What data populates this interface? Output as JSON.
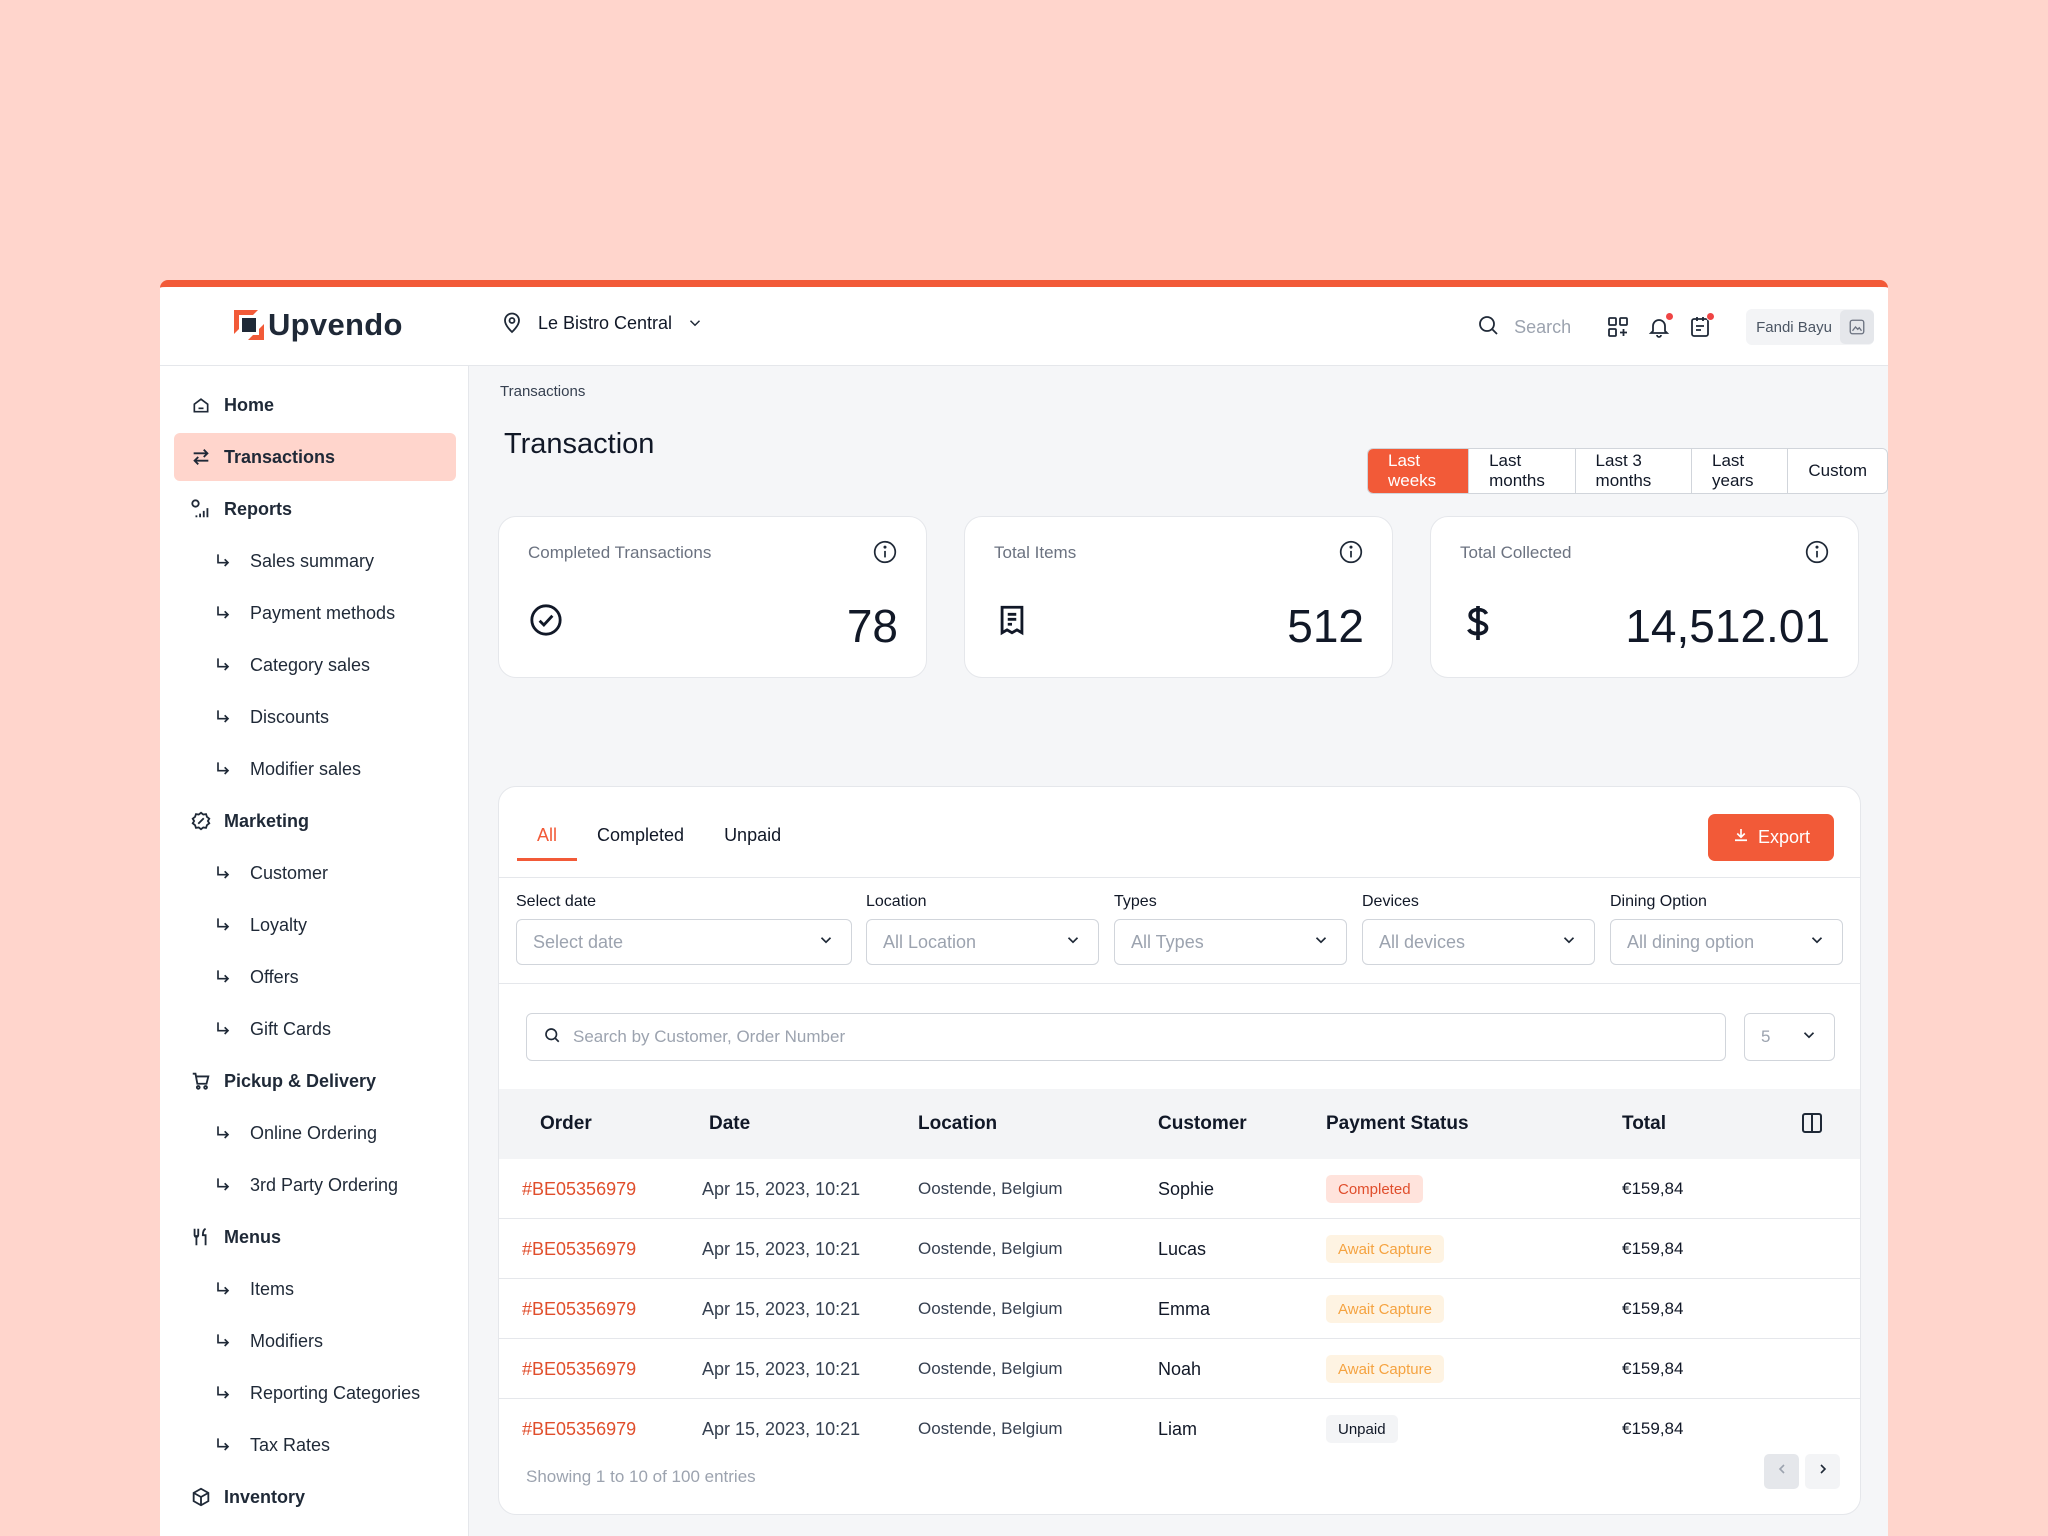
{
  "app": {
    "brand": "Upvendo",
    "accent": "#F25A38"
  },
  "header": {
    "location": "Le Bistro Central",
    "search_label": "Search",
    "user_name": "Fandi Bayu"
  },
  "sidebar": {
    "home": "Home",
    "transactions": "Transactions",
    "reports": "Reports",
    "reports_items": [
      "Sales summary",
      "Payment methods",
      "Category sales",
      "Discounts",
      "Modifier sales"
    ],
    "marketing": "Marketing",
    "marketing_items": [
      "Customer",
      "Loyalty",
      "Offers",
      "Gift Cards"
    ],
    "pickup": "Pickup & Delivery",
    "pickup_items": [
      "Online Ordering",
      "3rd Party Ordering"
    ],
    "menus": "Menus",
    "menus_items": [
      "Items",
      "Modifiers",
      "Reporting Categories",
      "Tax Rates"
    ],
    "inventory": "Inventory"
  },
  "main": {
    "breadcrumb": "Transactions",
    "title": "Transaction",
    "ranges": [
      "Last weeks",
      "Last months",
      "Last 3 months",
      "Last years",
      "Custom"
    ],
    "active_range": "Last weeks",
    "stats": [
      {
        "label": "Completed Transactions",
        "value": "78",
        "icon": "check-circle-icon"
      },
      {
        "label": "Total Items",
        "value": "512",
        "icon": "receipt-icon"
      },
      {
        "label": "Total Collected",
        "value": "14,512.01",
        "icon": "dollar-icon"
      }
    ]
  },
  "panel": {
    "tabs": [
      "All",
      "Completed",
      "Unpaid"
    ],
    "active_tab": "All",
    "export_label": "Export",
    "filters": [
      {
        "label": "Select date",
        "placeholder": "Select date"
      },
      {
        "label": "Location",
        "placeholder": "All Location"
      },
      {
        "label": "Types",
        "placeholder": "All Types"
      },
      {
        "label": "Devices",
        "placeholder": "All devices"
      },
      {
        "label": "Dining Option",
        "placeholder": "All dining option"
      }
    ],
    "search_placeholder": "Search by Customer, Order Number",
    "page_size": "5",
    "columns": [
      "Order",
      "Date",
      "Location",
      "Customer",
      "Payment Status",
      "Total"
    ],
    "rows": [
      {
        "order": "#BE05356979",
        "date": "Apr 15, 2023, 10:21",
        "location": "Oostende, Belgium",
        "customer": "Sophie",
        "status": "Completed",
        "status_type": "completed",
        "total": "€159,84"
      },
      {
        "order": "#BE05356979",
        "date": "Apr 15, 2023, 10:21",
        "location": "Oostende, Belgium",
        "customer": "Lucas",
        "status": "Await Capture",
        "status_type": "await",
        "total": "€159,84"
      },
      {
        "order": "#BE05356979",
        "date": "Apr 15, 2023, 10:21",
        "location": "Oostende, Belgium",
        "customer": "Emma",
        "status": "Await Capture",
        "status_type": "await",
        "total": "€159,84"
      },
      {
        "order": "#BE05356979",
        "date": "Apr 15, 2023, 10:21",
        "location": "Oostende, Belgium",
        "customer": "Noah",
        "status": "Await Capture",
        "status_type": "await",
        "total": "€159,84"
      },
      {
        "order": "#BE05356979",
        "date": "Apr 15, 2023, 10:21",
        "location": "Oostende, Belgium",
        "customer": "Liam",
        "status": "Unpaid",
        "status_type": "unpaid",
        "total": "€159,84"
      }
    ],
    "footer": "Showing 1 to 10 of 100 entries"
  }
}
